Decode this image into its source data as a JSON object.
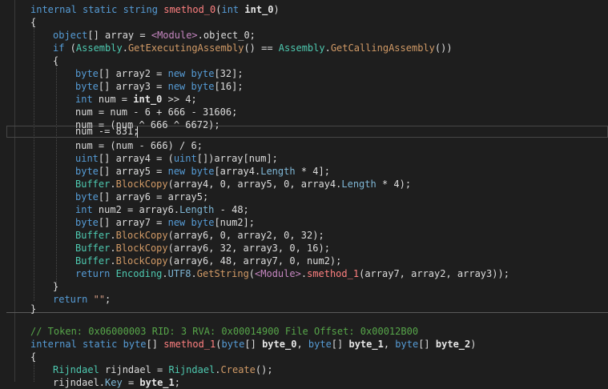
{
  "code": {
    "l1": {
      "kw1": "internal",
      "kw2": "static",
      "kw3": "string",
      "name": "smethod_0",
      "p1": "(",
      "kw4": "int",
      "param": "int_0",
      "p2": ")"
    },
    "l2": "{",
    "l3": {
      "kw": "object",
      "rest1": "[] array = ",
      "tmpl": "<Module>",
      "rest2": ".object_0;"
    },
    "l4": {
      "kw": "if",
      "p1": " (",
      "t1": "Assembly",
      "d1": ".",
      "m1": "GetExecutingAssembly",
      "mid": "() == ",
      "t2": "Assembly",
      "d2": ".",
      "m2": "GetCallingAssembly",
      "end": "())"
    },
    "l5": "{",
    "l6": {
      "kw": "byte",
      "r1": "[] array2 = ",
      "kw2": "new",
      "sp": " ",
      "kw3": "byte",
      "r2": "[32];"
    },
    "l7": {
      "kw": "byte",
      "r1": "[] array3 = ",
      "kw2": "new",
      "sp": " ",
      "kw3": "byte",
      "r2": "[16];"
    },
    "l8": {
      "kw": "int",
      "r1": " num = ",
      "b": "int_0",
      "r2": " >> 4;"
    },
    "l9": "num = num - 6 + 666 - 31606;",
    "l10": "num = (num ^ 666 ^ 6672);",
    "l11": "num -= 831;",
    "l12": "num = (num - 666) / 6;",
    "l13": {
      "kw": "uint",
      "r1": "[] array4 = (",
      "kw2": "uint",
      "r2": "[])array[num];"
    },
    "l14": {
      "kw": "byte",
      "r1": "[] array5 = ",
      "kw2": "new",
      "sp": " ",
      "kw3": "byte",
      "r2": "[array4.",
      "prop": "Length",
      "r3": " * 4];"
    },
    "l15": {
      "t": "Buffer",
      "d": ".",
      "m": "BlockCopy",
      "r1": "(array4, 0, array5, 0, array4.",
      "prop": "Length",
      "r2": " * 4);"
    },
    "l16": {
      "kw": "byte",
      "r1": "[] array6 = array5;"
    },
    "l17": {
      "kw": "int",
      "r1": " num2 = array6.",
      "prop": "Length",
      "r2": " - 48;"
    },
    "l18": {
      "kw": "byte",
      "r1": "[] array7 = ",
      "kw2": "new",
      "sp": " ",
      "kw3": "byte",
      "r2": "[num2];"
    },
    "l19": {
      "t": "Buffer",
      "d": ".",
      "m": "BlockCopy",
      "r1": "(array6, 0, array2, 0, 32);"
    },
    "l20": {
      "t": "Buffer",
      "d": ".",
      "m": "BlockCopy",
      "r1": "(array6, 32, array3, 0, 16);"
    },
    "l21": {
      "t": "Buffer",
      "d": ".",
      "m": "BlockCopy",
      "r1": "(array6, 48, array7, 0, num2);"
    },
    "l22": {
      "kw": "return",
      "sp": " ",
      "t": "Encoding",
      "d1": ".",
      "prop": "UTF8",
      "d2": ".",
      "m": "GetString",
      "r1": "(",
      "tmpl": "<Module>",
      "d3": ".",
      "m2": "smethod_1",
      "r2": "(array7, array2, array3));"
    },
    "l23": "}",
    "l24": {
      "kw": "return",
      "sp": " ",
      "str": "\"\"",
      "r": ";"
    },
    "l25": "}",
    "l26": "// Token: 0x06000003 RID: 3 RVA: 0x00014900 File Offset: 0x00012B00",
    "l27": {
      "kw1": "internal",
      "kw2": "static",
      "kw3": "byte",
      "r1": "[] ",
      "name": "smethod_1",
      "r2": "(",
      "kw4": "byte",
      "r3": "[] ",
      "b1": "byte_0",
      "r4": ", ",
      "kw5": "byte",
      "r5": "[] ",
      "b2": "byte_1",
      "r6": ", ",
      "kw6": "byte",
      "r7": "[] ",
      "b3": "byte_2",
      "r8": ")"
    },
    "l28": "{",
    "l29": {
      "t1": "Rijndael",
      "r1": " rijndael = ",
      "t2": "Rijndael",
      "d": ".",
      "m": "Create",
      "r2": "();"
    },
    "l30": {
      "r1": "rijndael.",
      "prop": "Key",
      "r2": " = ",
      "b": "byte_1",
      "r3": ";"
    }
  }
}
